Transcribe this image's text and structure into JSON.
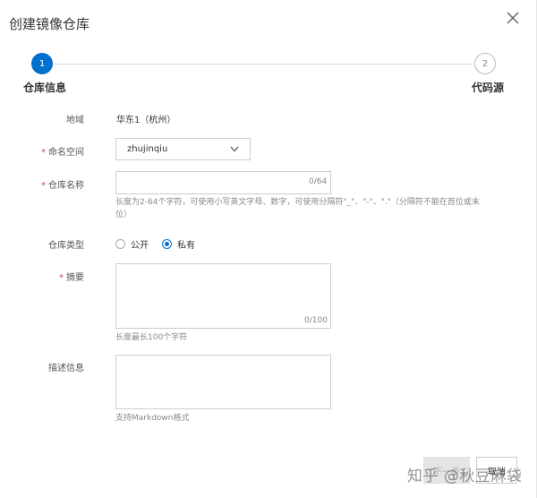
{
  "dialog": {
    "title": "创建镜像仓库",
    "close_icon": "close-icon"
  },
  "steps": [
    {
      "number": "1",
      "label": "仓库信息",
      "active": true
    },
    {
      "number": "2",
      "label": "代码源",
      "active": false
    }
  ],
  "form": {
    "region": {
      "label": "地域",
      "value": "华东1（杭州）"
    },
    "namespace": {
      "required_mark": "*",
      "label": "命名空间",
      "value": "zhujinqiu"
    },
    "repo_name": {
      "required_mark": "*",
      "label": "仓库名称",
      "value": "",
      "counter": "0/64",
      "help": "长度为2-64个字符，可使用小写英文字母、数字，可使用分隔符\"_\"、\"-\"、\".\"（分隔符不能在首位或末位）"
    },
    "repo_type": {
      "label": "仓库类型",
      "options": [
        {
          "label": "公开",
          "checked": false
        },
        {
          "label": "私有",
          "checked": true
        }
      ]
    },
    "summary": {
      "required_mark": "*",
      "label": "摘要",
      "value": "",
      "counter": "0/100",
      "help": "长度最长100个字符"
    },
    "description": {
      "label": "描述信息",
      "value": "",
      "help": "支持Markdown格式"
    }
  },
  "footer": {
    "next_label": "下一步",
    "cancel_label": "取消"
  },
  "watermark": "知乎 @秋豆麻袋",
  "colors": {
    "accent": "#0070cc",
    "required": "#e23c39",
    "muted": "#888888"
  }
}
